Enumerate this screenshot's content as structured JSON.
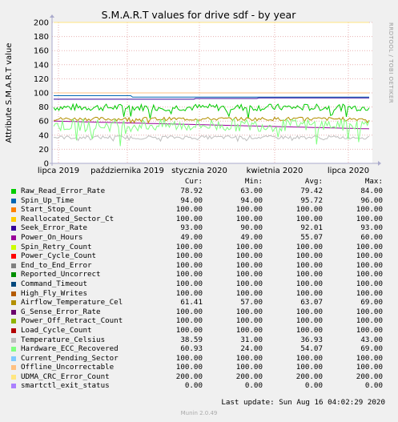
{
  "chart_data": {
    "type": "line",
    "title": "S.M.A.R.T values for drive sdf - by year",
    "ylabel": "Attribute S.M.A.R.T value",
    "ylim": [
      0,
      200
    ],
    "yticks": [
      0,
      20,
      40,
      60,
      80,
      100,
      120,
      140,
      160,
      180,
      200
    ],
    "xticks": [
      "lipca 2019",
      "października 2019",
      "stycznia 2020",
      "kwietnia 2020",
      "lipca 2020"
    ],
    "side_text": "RRDTOOL / TOBI OETIKER",
    "headers": [
      "Cur:",
      "Min:",
      "Avg:",
      "Max:"
    ],
    "series": [
      {
        "name": "Raw_Read_Error_Rate",
        "color": "#00cc00",
        "cur": "78.92",
        "min": "63.00",
        "avg": "79.42",
        "max": "84.00"
      },
      {
        "name": "Spin_Up_Time",
        "color": "#0066b3",
        "cur": "94.00",
        "min": "94.00",
        "avg": "95.72",
        "max": "96.00"
      },
      {
        "name": "Start_Stop_Count",
        "color": "#ff8000",
        "cur": "100.00",
        "min": "100.00",
        "avg": "100.00",
        "max": "100.00"
      },
      {
        "name": "Reallocated_Sector_Ct",
        "color": "#ffcc00",
        "cur": "100.00",
        "min": "100.00",
        "avg": "100.00",
        "max": "100.00"
      },
      {
        "name": "Seek_Error_Rate",
        "color": "#330099",
        "cur": "93.00",
        "min": "90.00",
        "avg": "92.01",
        "max": "93.00"
      },
      {
        "name": "Power_On_Hours",
        "color": "#990099",
        "cur": "49.00",
        "min": "49.00",
        "avg": "55.07",
        "max": "60.00"
      },
      {
        "name": "Spin_Retry_Count",
        "color": "#ccff00",
        "cur": "100.00",
        "min": "100.00",
        "avg": "100.00",
        "max": "100.00"
      },
      {
        "name": "Power_Cycle_Count",
        "color": "#ff0000",
        "cur": "100.00",
        "min": "100.00",
        "avg": "100.00",
        "max": "100.00"
      },
      {
        "name": "End_to_End_Error",
        "color": "#808080",
        "cur": "100.00",
        "min": "100.00",
        "avg": "100.00",
        "max": "100.00"
      },
      {
        "name": "Reported_Uncorrect",
        "color": "#008f00",
        "cur": "100.00",
        "min": "100.00",
        "avg": "100.00",
        "max": "100.00"
      },
      {
        "name": "Command_Timeout",
        "color": "#00487d",
        "cur": "100.00",
        "min": "100.00",
        "avg": "100.00",
        "max": "100.00"
      },
      {
        "name": "High_Fly_Writes",
        "color": "#b35a00",
        "cur": "100.00",
        "min": "100.00",
        "avg": "100.00",
        "max": "100.00"
      },
      {
        "name": "Airflow_Temperature_Cel",
        "color": "#b38f00",
        "cur": "61.41",
        "min": "57.00",
        "avg": "63.07",
        "max": "69.00"
      },
      {
        "name": "G_Sense_Error_Rate",
        "color": "#6b006b",
        "cur": "100.00",
        "min": "100.00",
        "avg": "100.00",
        "max": "100.00"
      },
      {
        "name": "Power_Off_Retract_Count",
        "color": "#8fb300",
        "cur": "100.00",
        "min": "100.00",
        "avg": "100.00",
        "max": "100.00"
      },
      {
        "name": "Load_Cycle_Count",
        "color": "#b30000",
        "cur": "100.00",
        "min": "100.00",
        "avg": "100.00",
        "max": "100.00"
      },
      {
        "name": "Temperature_Celsius",
        "color": "#bebebe",
        "cur": "38.59",
        "min": "31.00",
        "avg": "36.93",
        "max": "43.00"
      },
      {
        "name": "Hardware_ECC_Recovered",
        "color": "#80ff80",
        "cur": "60.93",
        "min": "24.00",
        "avg": "54.07",
        "max": "69.00"
      },
      {
        "name": "Current_Pending_Sector",
        "color": "#80c9ff",
        "cur": "100.00",
        "min": "100.00",
        "avg": "100.00",
        "max": "100.00"
      },
      {
        "name": "Offline_Uncorrectable",
        "color": "#ffc080",
        "cur": "100.00",
        "min": "100.00",
        "avg": "100.00",
        "max": "100.00"
      },
      {
        "name": "UDMA_CRC_Error_Count",
        "color": "#ffe680",
        "cur": "200.00",
        "min": "200.00",
        "avg": "200.00",
        "max": "200.00"
      },
      {
        "name": "smartctl_exit_status",
        "color": "#aa80ff",
        "cur": "0.00",
        "min": "0.00",
        "avg": "0.00",
        "max": "0.00"
      }
    ]
  },
  "footer": {
    "last_update": "Last update: Sun Aug 16 04:02:29 2020",
    "munin_version": "Munin 2.0.49"
  }
}
